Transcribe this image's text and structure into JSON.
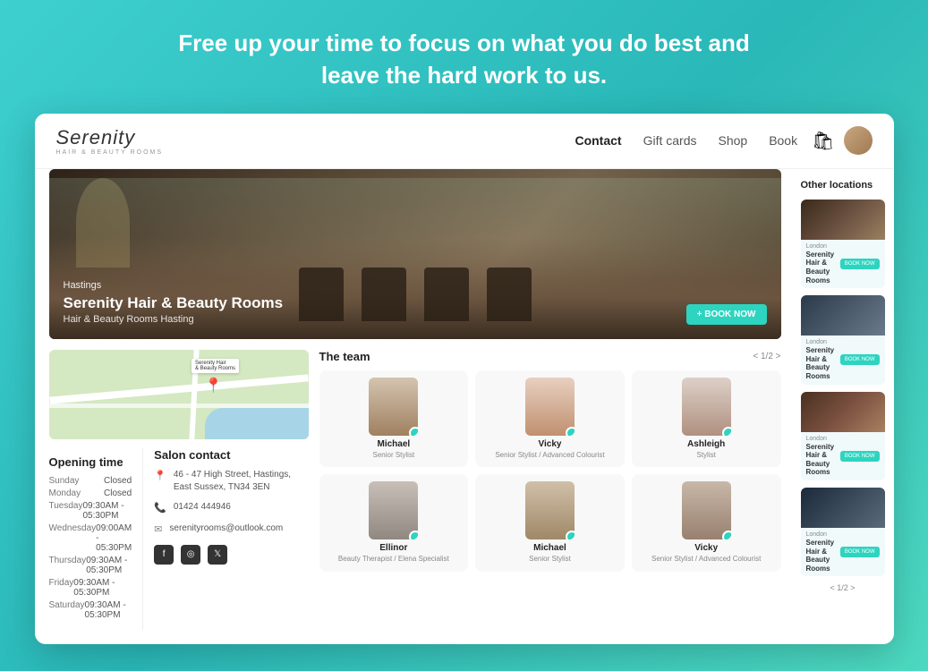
{
  "headline": {
    "line1": "Free up your time to focus on what you do best and",
    "line2": "leave the hard work to us."
  },
  "navbar": {
    "logo": "Serenity",
    "logo_subtitle": "HAIR & BEAUTY ROOMS",
    "links": [
      {
        "label": "Contact",
        "active": true
      },
      {
        "label": "Gift cards",
        "active": false
      },
      {
        "label": "Shop",
        "active": false
      },
      {
        "label": "Book",
        "active": false
      }
    ]
  },
  "hero": {
    "location": "Hastings",
    "title": "Serenity Hair & Beauty Rooms",
    "subtitle": "Hair & Beauty Rooms Hasting",
    "book_btn": "+ BOOK NOW"
  },
  "map": {
    "label": "Serenity Hair\n& Beauty Rooms"
  },
  "opening_times": {
    "title": "Opening time",
    "rows": [
      {
        "day": "Sunday",
        "time": "Closed"
      },
      {
        "day": "Monday",
        "time": "Closed"
      },
      {
        "day": "Tuesday",
        "time": "09:30AM - 05:30PM"
      },
      {
        "day": "Wednesday",
        "time": "09:00AM - 05:30PM"
      },
      {
        "day": "Thursday",
        "time": "09:30AM - 05:30PM"
      },
      {
        "day": "Friday",
        "time": "09:30AM - 05:30PM"
      },
      {
        "day": "Saturday",
        "time": "09:30AM - 05:30PM"
      }
    ]
  },
  "salon_contact": {
    "title": "Salon contact",
    "address": "46 - 47 High Street, Hastings, East Sussex, TN34 3EN",
    "phone": "01424 444946",
    "email": "serenityrooms@outlook.com"
  },
  "team": {
    "title": "The team",
    "nav": "< 1/2 >",
    "members": [
      {
        "name": "Michael",
        "role": "Senior Stylist",
        "avatar_class": "avatar-michael"
      },
      {
        "name": "Vicky",
        "role": "Senior Stylist / Advanced Colourist",
        "avatar_class": "avatar-vicky1"
      },
      {
        "name": "Ashleigh",
        "role": "Stylist",
        "avatar_class": "avatar-ashleigh"
      },
      {
        "name": "Ellinor",
        "role": "Beauty Therapist / Elena Specialist",
        "avatar_class": "avatar-ellinor"
      },
      {
        "name": "Michael",
        "role": "Senior Stylist",
        "avatar_class": "avatar-michael2"
      },
      {
        "name": "Vicky",
        "role": "Senior Stylist / Advanced Colourist",
        "avatar_class": "avatar-vicky2"
      }
    ]
  },
  "other_locations": {
    "title": "Other locations",
    "locations": [
      {
        "city": "London",
        "name": "Serenity Hair & Beauty Rooms",
        "img_class": "loc-img-1"
      },
      {
        "city": "London",
        "name": "Serenity Hair & Beauty Rooms",
        "img_class": "loc-img-2"
      },
      {
        "city": "London",
        "name": "Serenity Hair & Beauty Rooms",
        "img_class": "loc-img-3"
      },
      {
        "city": "London",
        "name": "Serenity Hair & Beauty Rooms",
        "img_class": "loc-img-4"
      }
    ],
    "book_label": "BOOK NOW",
    "pagination": "< 1/2 >"
  }
}
